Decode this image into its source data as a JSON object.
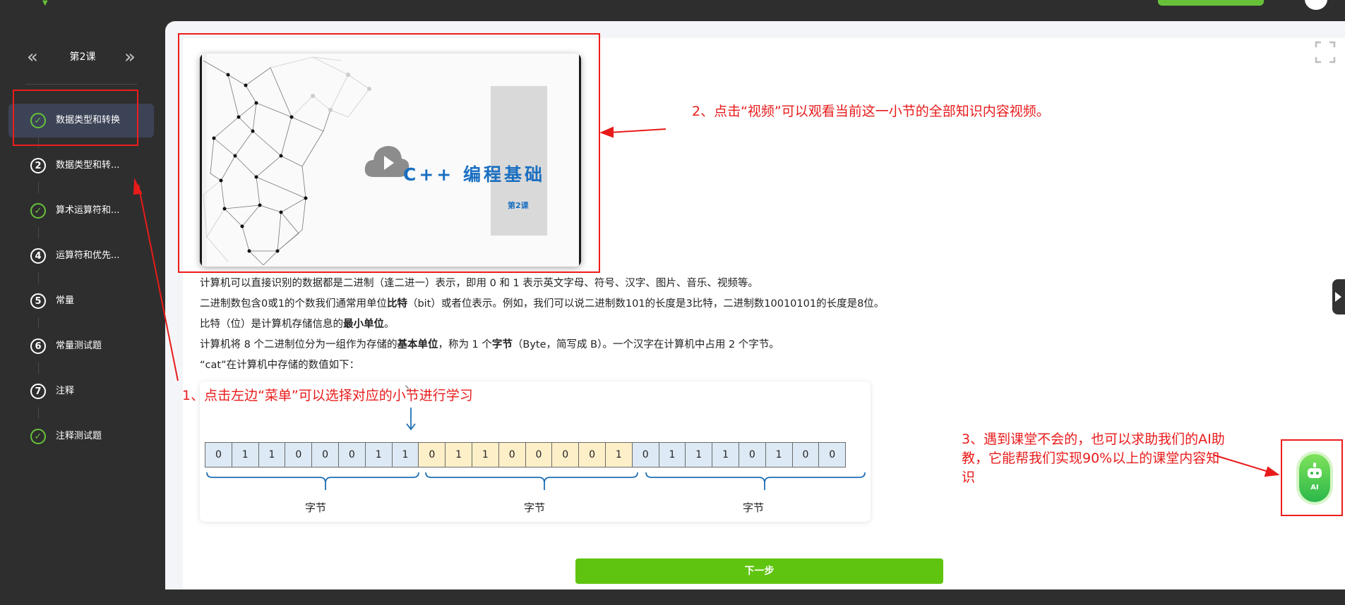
{
  "course": {
    "title": "第2课",
    "prev_icon": "«",
    "next_icon": "»"
  },
  "sidebar": {
    "items": [
      {
        "index": "1",
        "label": "数据类型和转换",
        "status": "done"
      },
      {
        "index": "2",
        "label": "数据类型和转...",
        "status": "todo"
      },
      {
        "index": "3",
        "label": "算术运算符和...",
        "status": "done"
      },
      {
        "index": "4",
        "label": "运算符和优先...",
        "status": "todo"
      },
      {
        "index": "5",
        "label": "常量",
        "status": "todo"
      },
      {
        "index": "6",
        "label": "常量测试题",
        "status": "todo"
      },
      {
        "index": "7",
        "label": "注释",
        "status": "todo"
      },
      {
        "index": "8",
        "label": "注释测试题",
        "status": "done"
      }
    ]
  },
  "video": {
    "title": "C++ 编程基础",
    "subtitle": "第2课"
  },
  "content": {
    "line1": "计算机可以直接识别的数据都是二进制（逢二进一）表示，即用 0 和 1 表示英文字母、符号、汉字、图片、音乐、视频等。",
    "line2_a": "二进制数包含0或1的个数我们通常用单位",
    "line2_b": "比特",
    "line2_c": "（bit）或者位表示。例如，我们可以说二进制数101的长度是3比特，二进制数10010101的长度是8位。",
    "line3_a": "比特（位）是计算机存储信息的",
    "line3_b": "最小单位",
    "line3_c": "。",
    "line4_a": "计算机将 8 个二进制位分为一组作为存储的",
    "line4_b": "基本单位",
    "line4_c": "，称为 1 个",
    "line4_d": "字节",
    "line4_e": "（Byte，简写成 B）。一个汉字在计算机中占用 2 个字节。",
    "line5": "“cat”在计算机中存储的数值如下："
  },
  "bits": {
    "bytes": [
      [
        "0",
        "1",
        "1",
        "0",
        "0",
        "0",
        "1",
        "1"
      ],
      [
        "0",
        "1",
        "1",
        "0",
        "0",
        "0",
        "0",
        "1"
      ],
      [
        "0",
        "1",
        "1",
        "1",
        "0",
        "1",
        "0",
        "0"
      ]
    ],
    "byte_label": "字节"
  },
  "next_button": "下一步",
  "ai_button": "AI",
  "annotations": {
    "a1": "1、点击左边“菜单”可以选择对应的小节进行学习",
    "a2": "2、点击“视频”可以观看当前这一小节的全部知识内容视频。",
    "a3": "3、遇到课堂不会的，也可以求助我们的AI助教，它能帮我们实现90%以上的课堂内容知识",
    "color": "#e81b1b"
  },
  "colors": {
    "accent_green": "#5fc40f",
    "sidebar_bg": "#2e2e2e",
    "active_item_bg": "#3c4356",
    "video_title_blue": "#1a6fc1"
  },
  "icons": {
    "check": "check-circle-icon",
    "fullscreen": "fullscreen-icon",
    "play": "cloud-play-icon",
    "robot": "robot-icon",
    "collapse": "triangle-right-icon"
  }
}
